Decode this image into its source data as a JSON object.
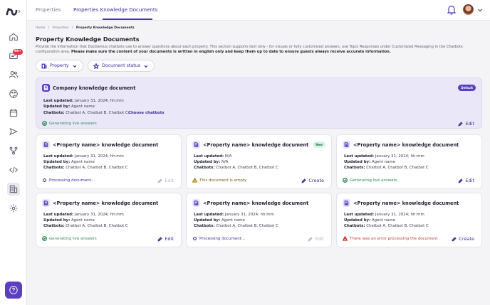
{
  "topbar": {
    "tabs": [
      {
        "label": "Properties"
      },
      {
        "label": "Properties Knowledge Documents"
      }
    ]
  },
  "sidebar": {
    "badge": "99+",
    "items": [
      "home-icon",
      "messages-icon",
      "users-icon",
      "palette-icon",
      "calendar-icon",
      "send-icon",
      "workflow-icon",
      "code-icon",
      "building-icon",
      "gear-icon"
    ]
  },
  "breadcrumb": [
    "Home",
    "/",
    "Properties",
    "/",
    "Property Knowledge Documents"
  ],
  "page": {
    "title": "Property Knowledge Documents",
    "description": "Provide the information that DocGenius chatbots use to answer questions about each property. This section supports text only - for visuals or fully customized answers, use Topic Responses under Customized Messaging in the Chatbots configuration area. ",
    "description_bold": "Please make sure the content of your documents is written in english only and keep them up to date to ensure guests always receive accurate information."
  },
  "filters": [
    {
      "label": "Property",
      "icon": "building-icon"
    },
    {
      "label": "Document status",
      "icon": "star-icon"
    }
  ],
  "labels": {
    "last_updated": "Last updated:",
    "updated_by": "Updated by:",
    "chatbots": "Chatbots:"
  },
  "company_doc": {
    "title": "Company knowledge document",
    "tag": "Default",
    "last_updated": "January 31, 2024; hh:mm",
    "updated_by": "Agent name",
    "chatbots": "Chatbot A, Chatbot B, Chatbot C.",
    "choose_chatbots": "Choose chatbots",
    "status": "Generating live answers",
    "action": "Edit"
  },
  "property_docs": [
    {
      "title": "<Property name> knowledge document",
      "tag": "",
      "last_updated": "January 31, 2024; hh:mm",
      "updated_by": "Agent name",
      "chatbots": "Chatbot A, Chatbot B, Chatbot C",
      "status": "Processing document...",
      "status_type": "proc",
      "action": "Edit",
      "action_disabled": true
    },
    {
      "title": "<Property name> knowledge document",
      "tag": "New",
      "last_updated": "N/A",
      "updated_by": "N/A",
      "chatbots": "Chatbot A, Chatbot B, Chatbot C",
      "status": "This document is empty",
      "status_type": "warn",
      "action": "Create",
      "action_disabled": false
    },
    {
      "title": "<Property name> knowledge document",
      "tag": "",
      "last_updated": "January 31, 2024; hh:mm",
      "updated_by": "Agent name",
      "chatbots": "Chatbot A, Chatbot B, Chatbot C",
      "status": "Generating live answers",
      "status_type": "live",
      "action": "Edit",
      "action_disabled": false
    },
    {
      "title": "<Property name> knowledge document",
      "tag": "",
      "last_updated": "January 31, 2024; hh:mm",
      "updated_by": "Agent name",
      "chatbots": "Chatbot A, Chatbot B, Chatbot C",
      "status": "Generating live answers",
      "status_type": "live",
      "action": "Edit",
      "action_disabled": false
    },
    {
      "title": "<Property name> knowledge document",
      "tag": "",
      "last_updated": "January 31, 2024; hh:mm",
      "updated_by": "Agent name",
      "chatbots": "Chatbot A, Chatbot B, Chatbot C",
      "status": "Processing document...",
      "status_type": "proc",
      "action": "Edit",
      "action_disabled": true
    },
    {
      "title": "<Property name> knowledge document",
      "tag": "",
      "last_updated": "January 31, 2024; hh:mm",
      "updated_by": "Agent name",
      "chatbots": "Chatbot A, Chatbot B, Chatbot C",
      "status": "There was an error processing the document",
      "status_type": "err",
      "action": "Create",
      "action_disabled": false
    }
  ],
  "colors": {
    "accent": "#5a3fc0",
    "live": "#2e8b57",
    "error": "#c0392b",
    "warn": "#b58a1b"
  }
}
